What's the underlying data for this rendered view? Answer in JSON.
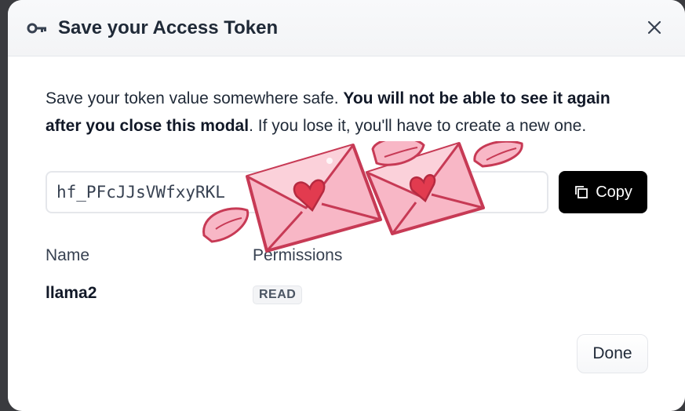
{
  "modal": {
    "title": "Save your Access Token",
    "close_icon": "close-icon",
    "key_icon": "key-icon"
  },
  "description": {
    "part1": "Save your token value somewhere safe. ",
    "bold": "You will not be able to see it again after you close this modal",
    "part2": ". If you lose it, you'll have to create a new one."
  },
  "token": {
    "value": "hf_PFcJJsVWfxyRKL"
  },
  "copy_button": {
    "label": "Copy",
    "icon": "copy-icon"
  },
  "details": {
    "name_header": "Name",
    "name_value": "llama2",
    "permissions_header": "Permissions",
    "permissions_value": "READ"
  },
  "done_button": {
    "label": "Done"
  },
  "colors": {
    "primary_button": "#000000",
    "envelope_pink": "#f8b7c6",
    "envelope_outline": "#c73a55",
    "heart_red": "#e23b4f"
  }
}
